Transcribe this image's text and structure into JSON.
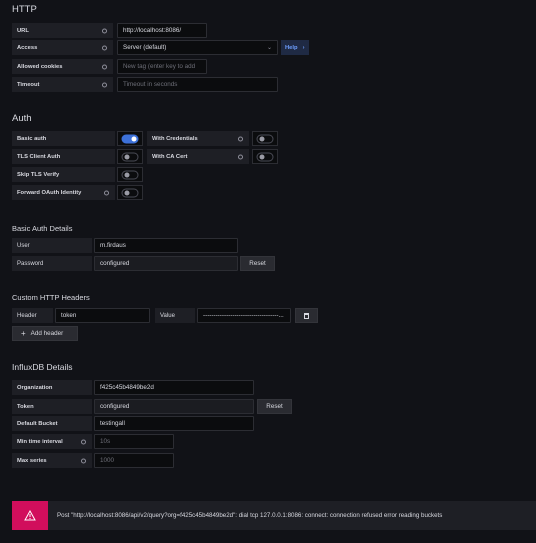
{
  "http": {
    "title": "HTTP",
    "url_label": "URL",
    "url_value": "http://localhost:8086/",
    "access_label": "Access",
    "access_value": "Server (default)",
    "help_label": "Help",
    "allowed_cookies_label": "Allowed cookies",
    "allowed_cookies_placeholder": "New tag (enter key to add",
    "timeout_label": "Timeout",
    "timeout_placeholder": "Timeout in seconds"
  },
  "auth": {
    "title": "Auth",
    "basic_auth_label": "Basic auth",
    "basic_auth_on": true,
    "with_credentials_label": "With Credentials",
    "with_credentials_on": false,
    "tls_client_auth_label": "TLS Client Auth",
    "tls_client_auth_on": false,
    "with_ca_cert_label": "With CA Cert",
    "with_ca_cert_on": false,
    "skip_tls_label": "Skip TLS Verify",
    "skip_tls_on": false,
    "forward_oauth_label": "Forward OAuth Identity",
    "forward_oauth_on": false
  },
  "basic_auth_details": {
    "title": "Basic Auth Details",
    "user_label": "User",
    "user_value": "m.firdaus",
    "password_label": "Password",
    "password_value": "configured",
    "reset_label": "Reset"
  },
  "custom_headers": {
    "title": "Custom HTTP Headers",
    "header_label": "Header",
    "header_value": "token",
    "value_label": "Value",
    "value_value": "------------------------------------...",
    "add_header_label": "Add header",
    "add_icon": "+"
  },
  "influx": {
    "title": "InfluxDB Details",
    "org_label": "Organization",
    "org_value": "f425c45b4849be2d",
    "token_label": "Token",
    "token_value": "configured",
    "reset_label": "Reset",
    "bucket_label": "Default Bucket",
    "bucket_value": "testingall",
    "min_interval_label": "Min time interval",
    "min_interval_placeholder": "10s",
    "max_series_label": "Max series",
    "max_series_placeholder": "1000"
  },
  "alert": {
    "message": "Post \"http://localhost:8086/api/v2/query?org=f425c45b4849be2d\": dial tcp 127.0.0.1:8086: connect: connection refused error reading buckets",
    "color": "#d10e5c"
  }
}
